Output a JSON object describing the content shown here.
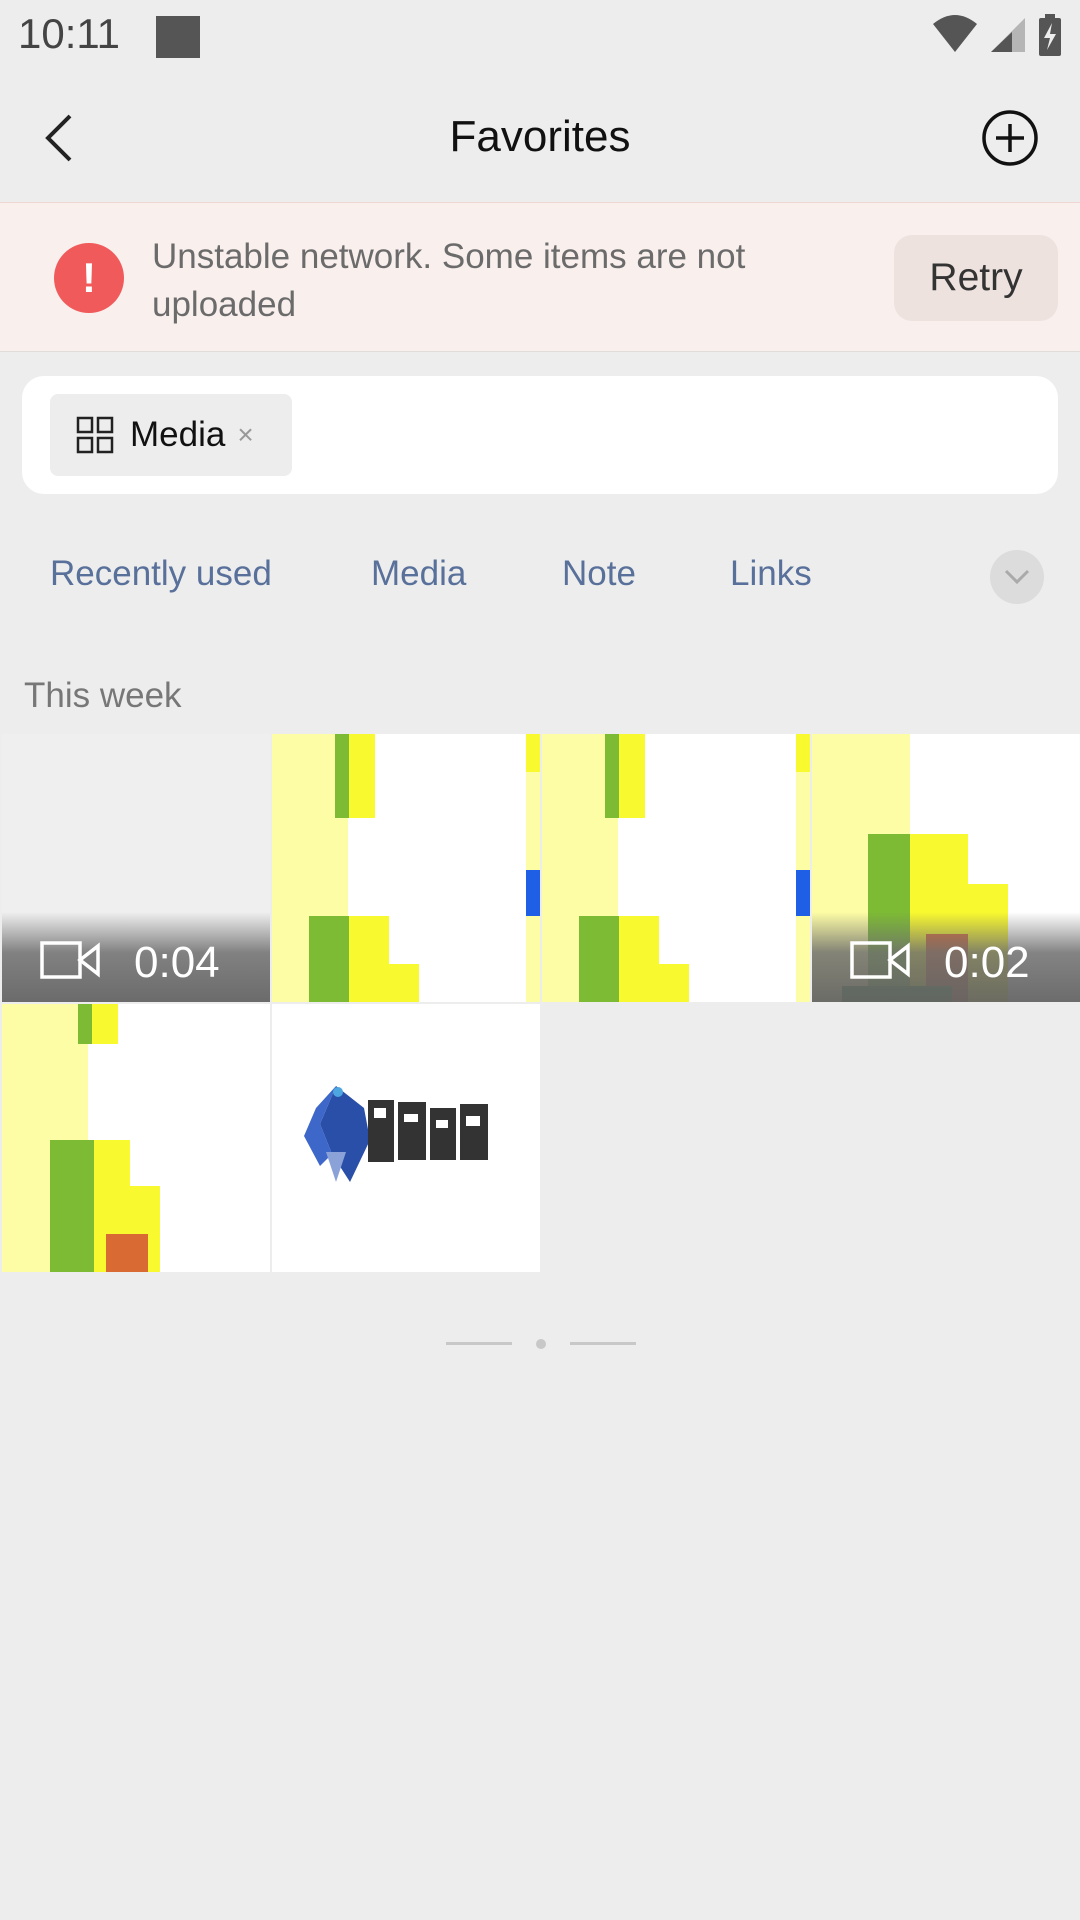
{
  "status_bar": {
    "time": "10:11"
  },
  "header": {
    "title": "Favorites",
    "back_icon": "chevron-left-icon",
    "add_icon": "plus-circle-icon"
  },
  "banner": {
    "message": "Unstable network. Some items are not uploaded",
    "retry_label": "Retry",
    "alert_glyph": "!",
    "alert_color": "#f05a5a"
  },
  "filter": {
    "chip_label": "Media",
    "chip_close": "×"
  },
  "categories": [
    "Recently used",
    "Media",
    "Note",
    "Links"
  ],
  "section": {
    "title": "This week"
  },
  "items": [
    {
      "type": "video",
      "duration": "0:04"
    },
    {
      "type": "image"
    },
    {
      "type": "image"
    },
    {
      "type": "video",
      "duration": "0:02"
    },
    {
      "type": "image"
    },
    {
      "type": "image"
    }
  ],
  "colors": {
    "accent_link": "#58709a",
    "banner_bg": "#f9efed",
    "page_bg": "#ededed"
  }
}
